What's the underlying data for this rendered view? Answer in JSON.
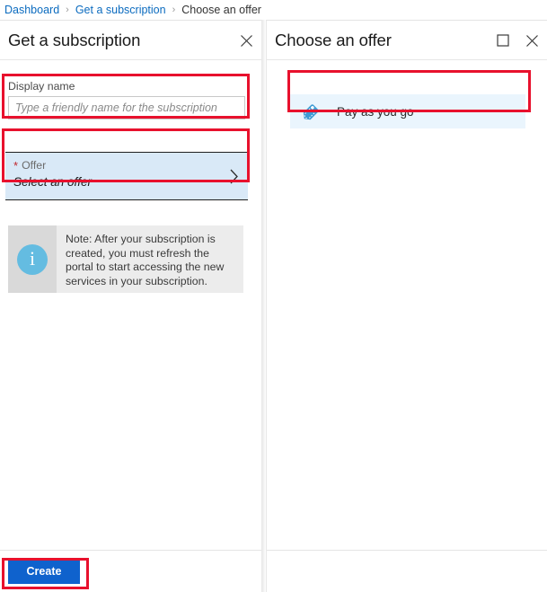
{
  "breadcrumb": {
    "items": [
      {
        "label": "Dashboard",
        "link": true
      },
      {
        "label": "Get a subscription",
        "link": true
      },
      {
        "label": "Choose an offer",
        "link": false
      }
    ],
    "separator": "›"
  },
  "left_panel": {
    "title": "Get a subscription",
    "close_label": "Close",
    "display_name": {
      "label": "Display name",
      "value": "",
      "placeholder": "Type a friendly name for the subscription"
    },
    "offer": {
      "required_marker": "*",
      "label": "Offer",
      "value": "Select an offer",
      "chevron": "chevron-right"
    },
    "note": {
      "icon": "info-icon",
      "icon_glyph": "i",
      "text": "Note: After your subscription is created, you must refresh the portal to start accessing the new services in your subscription."
    },
    "footer": {
      "create_label": "Create"
    }
  },
  "right_panel": {
    "title": "Choose an offer",
    "maximize_label": "Maximize",
    "close_label": "Close",
    "offers": [
      {
        "label": "Pay as you go",
        "icon": "price-tag-icon"
      }
    ]
  },
  "colors": {
    "accent_blue": "#0f62cd",
    "link_blue": "#0b6bbf",
    "highlight_red": "#e8112d",
    "selected_blue": "#d9e9f7",
    "row_blue": "#eaf5fd",
    "info_icon_blue": "#64bce1",
    "note_bg_gray": "#d9d9d9"
  }
}
